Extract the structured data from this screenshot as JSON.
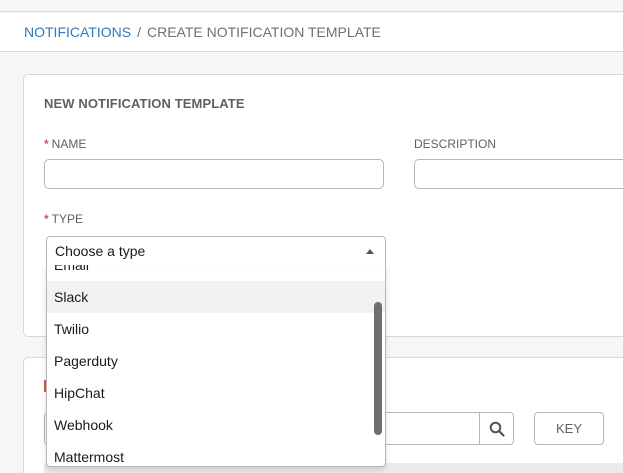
{
  "breadcrumb": {
    "parent": "NOTIFICATIONS",
    "separator": "/",
    "current": "CREATE NOTIFICATION TEMPLATE"
  },
  "form": {
    "title": "NEW NOTIFICATION TEMPLATE",
    "required_marker": "*",
    "name_label": "NAME",
    "name_value": "",
    "description_label": "DESCRIPTION",
    "description_value": "",
    "type_label": "TYPE",
    "type_select": {
      "selected": "Choose a type",
      "options": [
        "Email",
        "Slack",
        "Twilio",
        "Pagerduty",
        "HipChat",
        "Webhook",
        "Mattermost"
      ],
      "highlighted": "Slack"
    }
  },
  "lower_panel": {
    "key_button": "KEY"
  },
  "icons": {
    "search": "search-icon",
    "caret": "caret-up-icon"
  },
  "colors": {
    "link": "#337ab7",
    "required": "#d9534f",
    "border": "#b7b7b7",
    "highlight": "#f2f2f2"
  }
}
